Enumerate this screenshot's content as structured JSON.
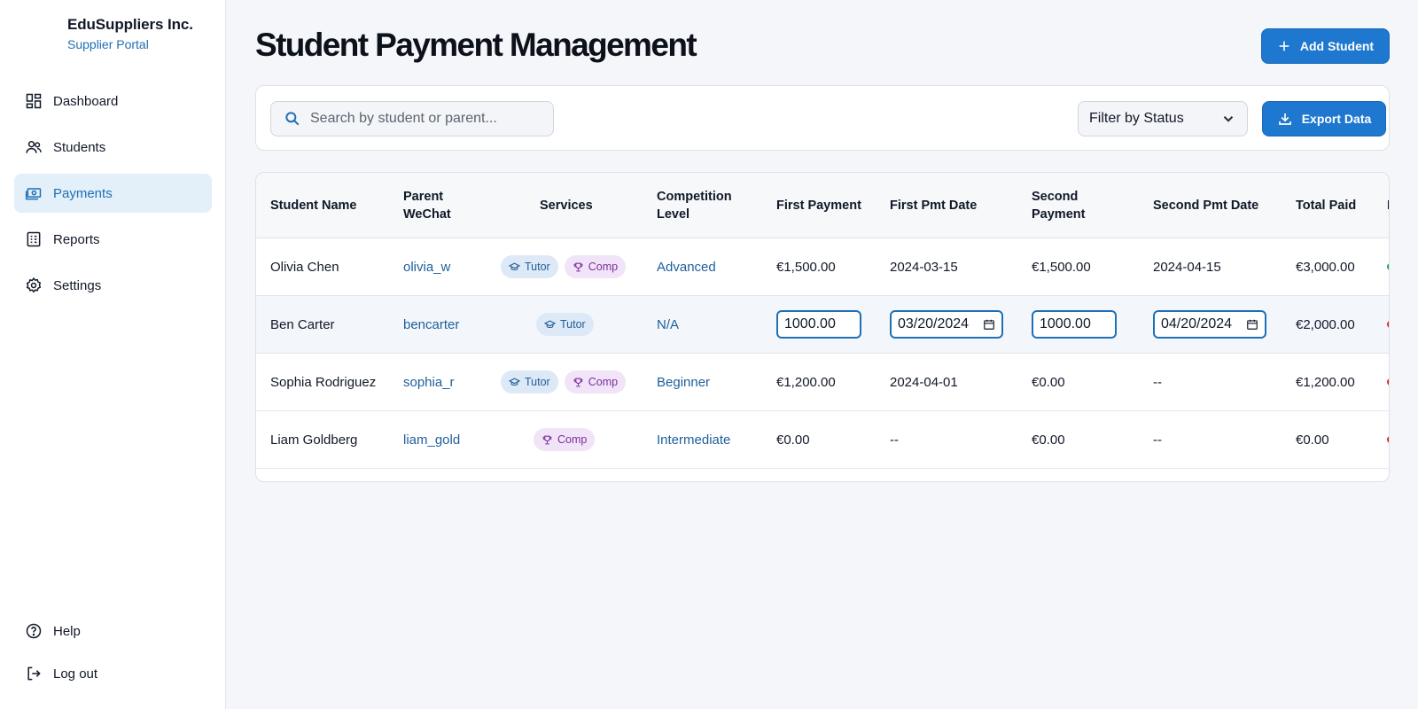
{
  "brand": {
    "name": "EduSuppliers Inc.",
    "subtitle": "Supplier Portal"
  },
  "sidebar": {
    "items": [
      {
        "label": "Dashboard",
        "icon": "dashboard-icon",
        "active": false
      },
      {
        "label": "Students",
        "icon": "users-icon",
        "active": false
      },
      {
        "label": "Payments",
        "icon": "payments-icon",
        "active": true
      },
      {
        "label": "Reports",
        "icon": "reports-icon",
        "active": false
      },
      {
        "label": "Settings",
        "icon": "gear-icon",
        "active": false
      }
    ],
    "bottom": [
      {
        "label": "Help",
        "icon": "help-icon"
      },
      {
        "label": "Log out",
        "icon": "logout-icon"
      }
    ]
  },
  "header": {
    "title": "Student Payment Management",
    "add_label": "Add Student"
  },
  "toolbar": {
    "search_placeholder": "Search by student or parent...",
    "filter_label": "Filter by Status",
    "export_label": "Export Data"
  },
  "table": {
    "columns": [
      "Student Name",
      "Parent WeChat",
      "Services",
      "Competition Level",
      "First Payment",
      "First Pmt Date",
      "Second Payment",
      "Second Pmt Date",
      "Total Paid",
      "I"
    ],
    "rows": [
      {
        "name": "Olivia Chen",
        "wechat": "olivia_w",
        "services": [
          "Tutor",
          "Comp"
        ],
        "level": "Advanced",
        "first_payment": "€1,500.00",
        "first_date": "2024-03-15",
        "second_payment": "€1,500.00",
        "second_date": "2024-04-15",
        "total": "€3,000.00",
        "status_color": "#22a34a"
      },
      {
        "name": "Ben Carter",
        "wechat": "bencarter",
        "services": [
          "Tutor"
        ],
        "level": "N/A",
        "first_payment": "1000.00",
        "first_date": "03/20/2024",
        "second_payment": "1000.00",
        "second_date": "04/20/2024",
        "total": "€2,000.00",
        "status_color": "#dc2626",
        "editing": true
      },
      {
        "name": "Sophia Rodriguez",
        "wechat": "sophia_r",
        "services": [
          "Tutor",
          "Comp"
        ],
        "level": "Beginner",
        "first_payment": "€1,200.00",
        "first_date": "2024-04-01",
        "second_payment": "€0.00",
        "second_date": "--",
        "total": "€1,200.00",
        "status_color": "#dc2626"
      },
      {
        "name": "Liam Goldberg",
        "wechat": "liam_gold",
        "services": [
          "Comp"
        ],
        "level": "Intermediate",
        "first_payment": "€0.00",
        "first_date": "--",
        "second_payment": "€0.00",
        "second_date": "--",
        "total": "€0.00",
        "status_color": "#dc2626"
      }
    ]
  },
  "colors": {
    "accent": "#1f78cf",
    "link": "#1f5f9a",
    "active_bg": "#e3eff9"
  }
}
